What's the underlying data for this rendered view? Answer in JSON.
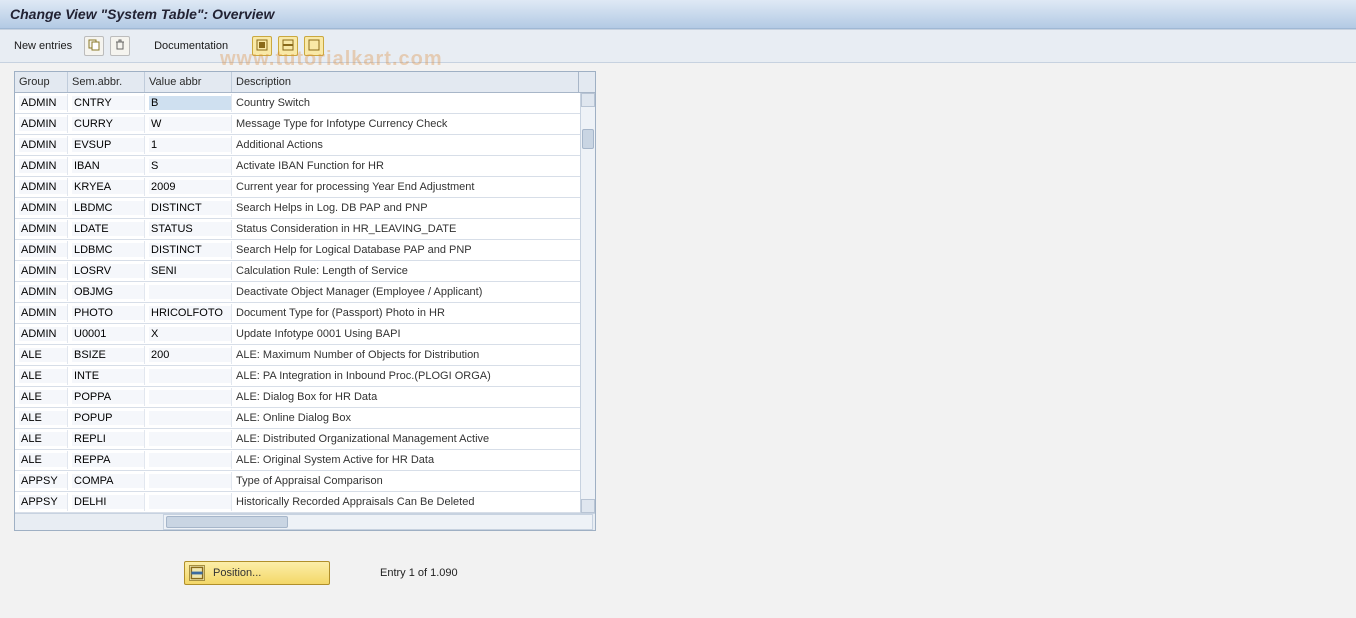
{
  "header": {
    "title": "Change View \"System Table\": Overview"
  },
  "toolbar": {
    "new_entries": "New entries",
    "documentation": "Documentation"
  },
  "watermark": "www.tutorialkart.com",
  "columns": {
    "group": "Group",
    "sem": "Sem.abbr.",
    "val": "Value abbr",
    "desc": "Description"
  },
  "rows": [
    {
      "g": "ADMIN",
      "s": "CNTRY",
      "v": "B",
      "d": "Country Switch",
      "hl": true
    },
    {
      "g": "ADMIN",
      "s": "CURRY",
      "v": "W",
      "d": "Message Type for Infotype Currency Check"
    },
    {
      "g": "ADMIN",
      "s": "EVSUP",
      "v": "1",
      "d": "Additional Actions"
    },
    {
      "g": "ADMIN",
      "s": "IBAN",
      "v": "S",
      "d": "Activate IBAN Function for HR"
    },
    {
      "g": "ADMIN",
      "s": "KRYEA",
      "v": "2009",
      "d": "Current year for processing Year End Adjustment"
    },
    {
      "g": "ADMIN",
      "s": "LBDMC",
      "v": "DISTINCT",
      "d": "Search Helps in Log. DB PAP and PNP"
    },
    {
      "g": "ADMIN",
      "s": "LDATE",
      "v": "STATUS",
      "d": "Status Consideration in HR_LEAVING_DATE"
    },
    {
      "g": "ADMIN",
      "s": "LDBMC",
      "v": "DISTINCT",
      "d": "Search Help for Logical Database PAP and PNP"
    },
    {
      "g": "ADMIN",
      "s": "LOSRV",
      "v": "SENI",
      "d": "Calculation Rule: Length of Service"
    },
    {
      "g": "ADMIN",
      "s": "OBJMG",
      "v": "",
      "d": "Deactivate Object Manager (Employee / Applicant)"
    },
    {
      "g": "ADMIN",
      "s": "PHOTO",
      "v": "HRICOLFOTO",
      "d": "Document Type for (Passport) Photo in HR"
    },
    {
      "g": "ADMIN",
      "s": "U0001",
      "v": "X",
      "d": "Update Infotype 0001 Using BAPI"
    },
    {
      "g": "ALE",
      "s": "BSIZE",
      "v": "200",
      "d": "ALE: Maximum Number of Objects for Distribution"
    },
    {
      "g": "ALE",
      "s": "INTE",
      "v": "",
      "d": "ALE: PA Integration in Inbound Proc.(PLOGI ORGA)"
    },
    {
      "g": "ALE",
      "s": "POPPA",
      "v": "",
      "d": "ALE: Dialog Box for HR Data"
    },
    {
      "g": "ALE",
      "s": "POPUP",
      "v": "",
      "d": "ALE: Online Dialog Box"
    },
    {
      "g": "ALE",
      "s": "REPLI",
      "v": "",
      "d": "ALE: Distributed Organizational Management Active"
    },
    {
      "g": "ALE",
      "s": "REPPA",
      "v": "",
      "d": "ALE: Original System Active for HR Data"
    },
    {
      "g": "APPSY",
      "s": "COMPA",
      "v": "",
      "d": "Type of Appraisal Comparison"
    },
    {
      "g": "APPSY",
      "s": "DELHI",
      "v": "",
      "d": "Historically Recorded Appraisals Can Be Deleted"
    }
  ],
  "footer": {
    "position_btn": "Position...",
    "entry_info": "Entry 1 of 1.090"
  }
}
